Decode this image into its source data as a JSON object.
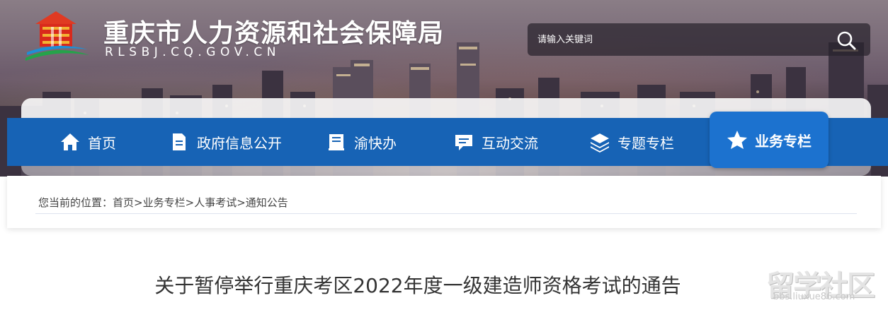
{
  "header": {
    "site_title": "重庆市人力资源和社会保障局",
    "site_domain": "RLSBJ.CQ.GOV.CN"
  },
  "search": {
    "placeholder": "请输入关键词",
    "icon": "search-icon"
  },
  "nav": {
    "items": [
      {
        "label": "首页",
        "icon": "home-icon"
      },
      {
        "label": "政府信息公开",
        "icon": "document-icon"
      },
      {
        "label": "渝快办",
        "icon": "book-icon"
      },
      {
        "label": "互动交流",
        "icon": "chat-icon"
      },
      {
        "label": "专题专栏",
        "icon": "layers-icon"
      },
      {
        "label": "业务专栏",
        "icon": "star-icon",
        "active": true
      }
    ]
  },
  "breadcrumb": {
    "prefix": "您当前的位置：",
    "items": [
      "首页",
      "业务专栏",
      "人事考试",
      "通知公告"
    ],
    "separator": ">"
  },
  "article": {
    "title": "关于暂停举行重庆考区2022年度一级建造师资格考试的通告"
  },
  "watermark": {
    "text": "留学社区",
    "url": "bbs.liuxue86.com"
  },
  "colors": {
    "nav_bg": "#1763b5",
    "nav_active": "#1c72cf"
  }
}
